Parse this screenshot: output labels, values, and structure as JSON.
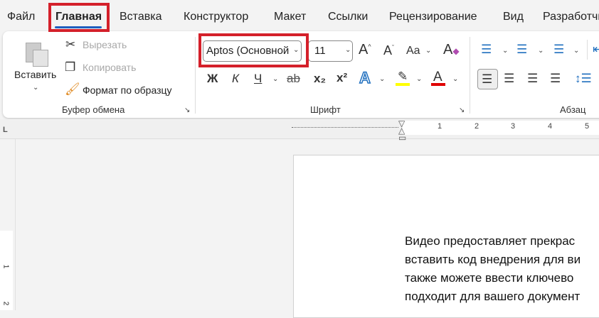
{
  "tabs": [
    "Файл",
    "Главная",
    "Вставка",
    "Конструктор",
    "Макет",
    "Ссылки",
    "Рецензирование",
    "Вид",
    "Разработчик"
  ],
  "active_tab": "Главная",
  "clipboard": {
    "paste": "Вставить",
    "cut": "Вырезать",
    "copy": "Копировать",
    "format_painter": "Формат по образцу",
    "group": "Буфер обмена"
  },
  "font": {
    "name": "Aptos (Основной",
    "size": "11",
    "group": "Шрифт",
    "bold": "Ж",
    "italic": "К",
    "underline": "Ч",
    "strike": "ab",
    "subscript": "x₂",
    "superscript": "x²",
    "case": "Aa",
    "grow": "A",
    "shrink": "A",
    "effects": "A",
    "color": "A"
  },
  "paragraph": {
    "group": "Абзац"
  },
  "ruler": [
    "1",
    "2",
    "3",
    "4",
    "5"
  ],
  "vruler": [
    "1",
    "2"
  ],
  "document": {
    "lines": [
      "Видео предоставляет прекрас",
      "вставить код внедрения для ви",
      "также можете ввести ключево",
      "подходит для вашего документ"
    ]
  },
  "colors": {
    "highlight": "#ffff00",
    "font_color": "#e00000",
    "accent": "#1f5fbf",
    "callout": "#d4202a"
  }
}
